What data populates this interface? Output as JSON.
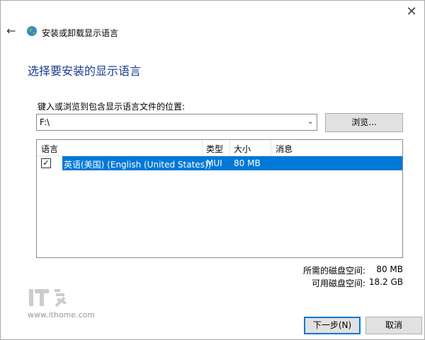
{
  "window": {
    "title": "安装或卸载显示语言"
  },
  "heading": "选择要安装的显示语言",
  "path": {
    "label": "键入或浏览到包含显示语言文件的位置:",
    "value": "F:\\",
    "browse_label": "浏览..."
  },
  "table": {
    "columns": [
      "语言",
      "类型",
      "大小",
      "消息"
    ],
    "rows": [
      {
        "checked": true,
        "language": "英语(美国) (English (United States))",
        "type": "MUI",
        "size": "80 MB",
        "message": ""
      }
    ]
  },
  "space": {
    "required_label": "所需的磁盘空间:",
    "required_value": "80 MB",
    "available_label": "可用磁盘空间:",
    "available_value": "18.2 GB"
  },
  "watermark": {
    "logo_text": "IT之家",
    "url": "www.ithome.com"
  },
  "buttons": {
    "next": "下一步(N)",
    "cancel": "取消"
  },
  "colors": {
    "heading": "#1a3c8f",
    "selection": "#0078d7",
    "accent": "#0078d7"
  },
  "icons": {
    "close": "close-icon",
    "back": "back-arrow-icon",
    "title": "globe-icon",
    "dropdown": "chevron-down-icon",
    "checkbox": "checkbox-icon"
  }
}
